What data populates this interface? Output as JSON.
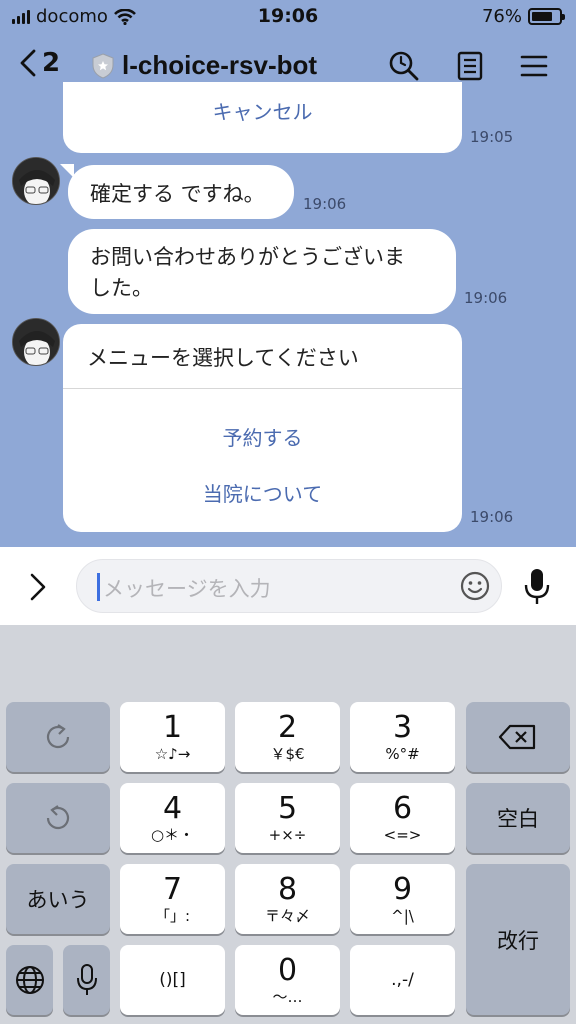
{
  "status_bar": {
    "carrier": "docomo",
    "time": "19:06",
    "battery": "76%",
    "battery_level": 0.76
  },
  "header": {
    "back_count": "2",
    "title": "l-choice-rsv-bot"
  },
  "messages": {
    "cancel_action": "キャンセル",
    "cancel_time": "19:05",
    "confirm_text": "確定する ですね。",
    "confirm_time": "19:06",
    "thanks_line1": "お問い合わせありがとうございま",
    "thanks_line2": "した。",
    "thanks_time": "19:06",
    "menu_title": "メニューを選択してください",
    "menu_action_reserve": "予約する",
    "menu_action_about": "当院について",
    "menu_time": "19:06"
  },
  "input": {
    "placeholder": "メッセージを入力"
  },
  "keyboard": {
    "k1": {
      "main": "1",
      "sub": "☆♪→"
    },
    "k2": {
      "main": "2",
      "sub": "￥$€"
    },
    "k3": {
      "main": "3",
      "sub": "%°#"
    },
    "k4": {
      "main": "4",
      "sub": "○＊・"
    },
    "k5": {
      "main": "5",
      "sub": "+×÷"
    },
    "k6": {
      "main": "6",
      "sub": "<=>"
    },
    "k7": {
      "main": "7",
      "sub": "「」:"
    },
    "k8": {
      "main": "8",
      "sub": "〒々〆"
    },
    "k9": {
      "main": "9",
      "sub": "^|\\"
    },
    "k0": {
      "main": "0",
      "sub": "〜…"
    },
    "brackets": "()[]",
    "punct": ".,-/",
    "space": "空白",
    "kana": "あいう",
    "enter": "改行"
  },
  "colors": {
    "chat_bg": "#8fa8d6",
    "action_text": "#4b6bb0",
    "caret": "#3d6fe0",
    "keyboard_bg": "#d1d4da"
  }
}
